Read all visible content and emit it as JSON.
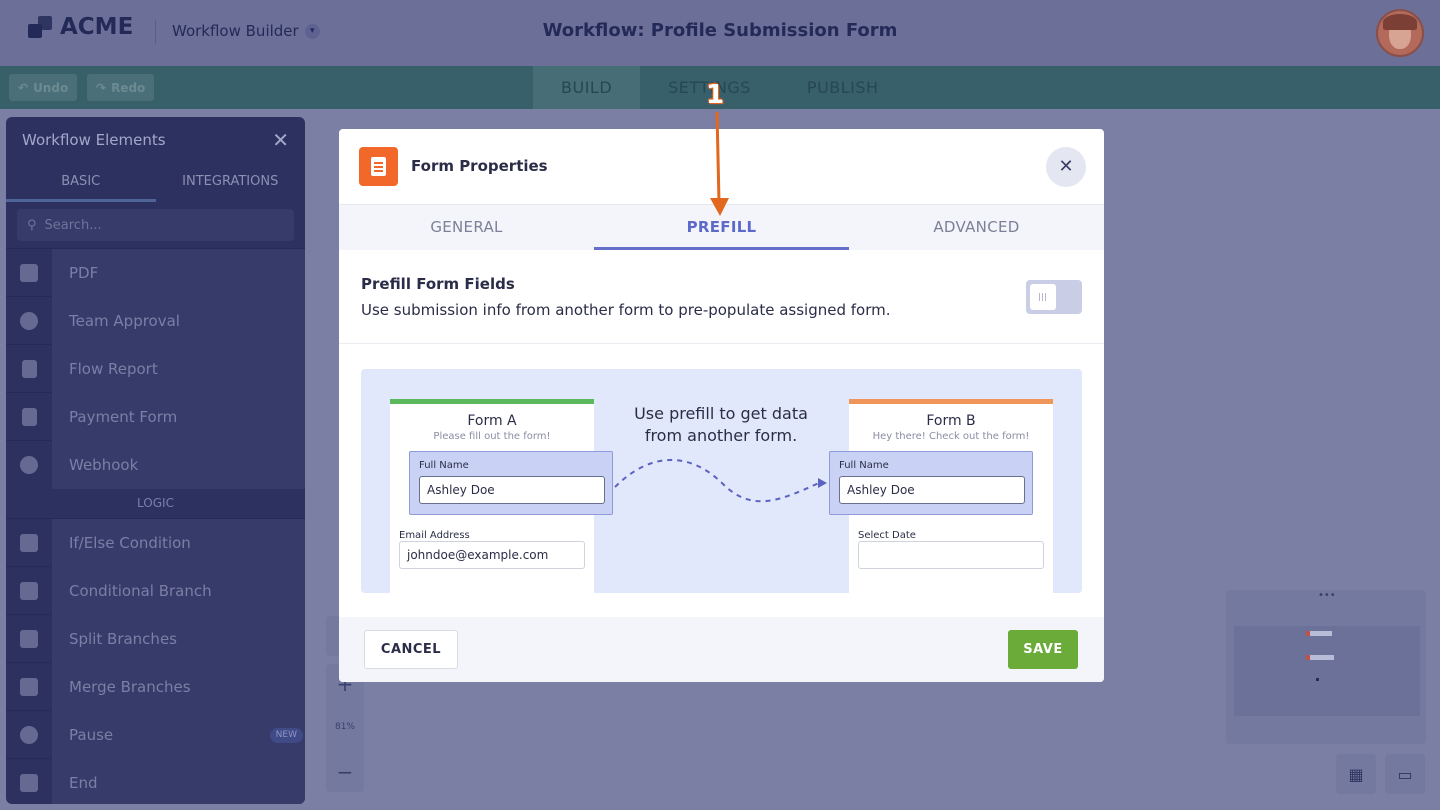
{
  "header": {
    "logo_text": "ACME",
    "app_name": "Workflow Builder",
    "page_title": "Workflow: Profile Submission Form"
  },
  "toolbar": {
    "undo_label": "Undo",
    "redo_label": "Redo",
    "tabs": [
      "BUILD",
      "SETTINGS",
      "PUBLISH"
    ],
    "active_tab": "BUILD"
  },
  "sidebar": {
    "title": "Workflow Elements",
    "tabs": [
      "BASIC",
      "INTEGRATIONS"
    ],
    "search_placeholder": "Search...",
    "basic_items": [
      "PDF",
      "Team Approval",
      "Flow Report",
      "Payment Form",
      "Webhook"
    ],
    "section_label": "LOGIC",
    "logic_items": [
      "If/Else Condition",
      "Conditional Branch",
      "Split Branches",
      "Merge Branches",
      "Pause",
      "End"
    ],
    "new_badge": "NEW"
  },
  "canvas": {
    "zoom_plus": "+",
    "zoom_level": "81%",
    "zoom_minus": "−"
  },
  "modal": {
    "title": "Form Properties",
    "tabs": [
      "GENERAL",
      "PREFILL",
      "ADVANCED"
    ],
    "active_tab": "PREFILL",
    "section_title": "Prefill Form Fields",
    "section_desc": "Use submission info from another form to pre-populate assigned form.",
    "toggle_on": false,
    "illustration": {
      "caption": "Use prefill to get data from another form.",
      "form_a": {
        "title": "Form A",
        "subtitle": "Please fill out the form!",
        "name_label": "Full Name",
        "name_value": "Ashley Doe",
        "email_label": "Email Address",
        "email_value": "johndoe@example.com"
      },
      "form_b": {
        "title": "Form B",
        "subtitle": "Hey there! Check out the form!",
        "name_label": "Full Name",
        "name_value": "Ashley Doe",
        "date_label": "Select Date"
      }
    },
    "cancel_label": "CANCEL",
    "save_label": "SAVE"
  },
  "annotation": {
    "number": "1"
  },
  "colors": {
    "accent": "#6470c9",
    "save_green": "#6aab3a",
    "form_icon_orange": "#f2682a",
    "form_a_bar": "#5cb85c",
    "form_b_bar": "#f0955a",
    "annotation_orange": "#e2671f"
  }
}
